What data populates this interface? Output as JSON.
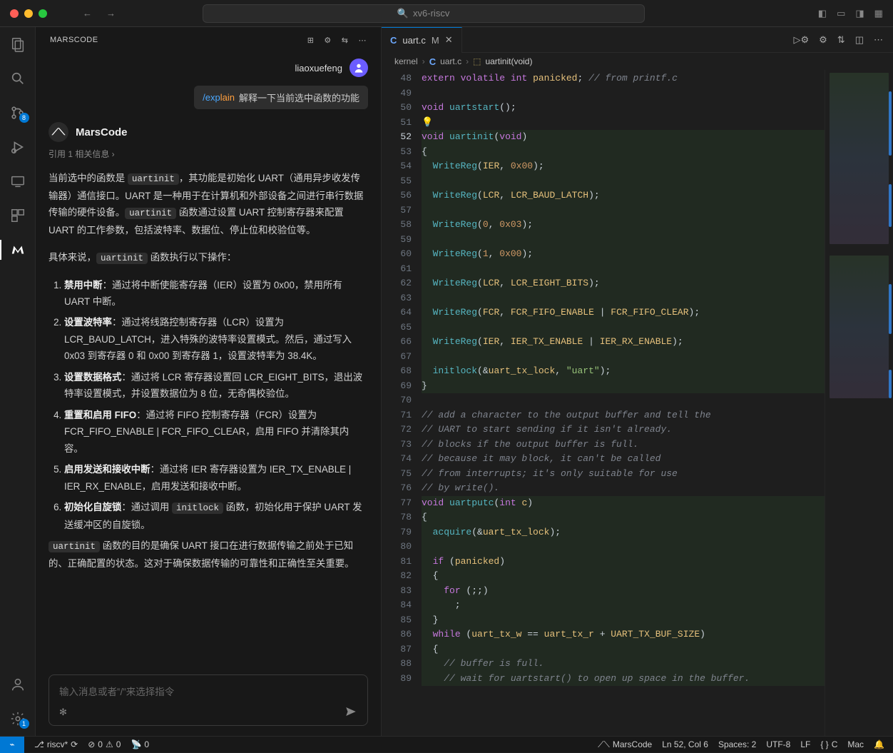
{
  "search": {
    "placeholder": "xv6-riscv"
  },
  "activity": {
    "scm_badge": "8",
    "settings_badge": "1"
  },
  "sidebar": {
    "title": "MARSCODE",
    "username": "liaoxuefeng",
    "explain_cmd_prefix": "/exp",
    "explain_cmd_suffix": "lain",
    "explain_text": "解释一下当前选中函数的功能",
    "assistant": "MarsCode",
    "ref": "引用 1 相关信息 ›",
    "p1a": "当前选中的函数是 ",
    "code_uartinit": "uartinit",
    "p1b": "，其功能是初始化 UART（通用异步收发传输器）通信接口。UART 是一种用于在计算机和外部设备之间进行串行数据传输的硬件设备。",
    "p1c": " 函数通过设置 UART 控制寄存器来配置 UART 的工作参数，包括波特率、数据位、停止位和校验位等。",
    "p2a": "具体来说，",
    "p2b": " 函数执行以下操作：",
    "items": [
      {
        "b": "禁用中断",
        "t": "：通过将中断使能寄存器（IER）设置为 0x00，禁用所有 UART 中断。"
      },
      {
        "b": "设置波特率",
        "t": "：通过将线路控制寄存器（LCR）设置为 LCR_BAUD_LATCH，进入特殊的波特率设置模式。然后，通过写入 0x03 到寄存器 0 和 0x00 到寄存器 1，设置波特率为 38.4K。"
      },
      {
        "b": "设置数据格式",
        "t": "：通过将 LCR 寄存器设置回 LCR_EIGHT_BITS，退出波特率设置模式，并设置数据位为 8 位，无奇偶校验位。"
      },
      {
        "b": "重置和启用 FIFO",
        "t": "：通过将 FIFO 控制寄存器（FCR）设置为 FCR_FIFO_ENABLE | FCR_FIFO_CLEAR，启用 FIFO 并清除其内容。"
      },
      {
        "b": "启用发送和接收中断",
        "t": "：通过将 IER 寄存器设置为 IER_TX_ENABLE | IER_RX_ENABLE，启用发送和接收中断。"
      },
      {
        "b": "初始化自旋锁",
        "t_pre": "：通过调用 ",
        "code": "initlock",
        "t_post": " 函数，初始化用于保护 UART 发送缓冲区的自旋锁。"
      }
    ],
    "p3a": " 函数的目的是确保 UART 接口在进行数据传输之前处于已知的、正确配置的状态。这对于确保数据传输的可靠性和正确性至关重要。",
    "input_placeholder": "输入消息或者‟/”来选择指令"
  },
  "editor": {
    "tab": {
      "lang": "C",
      "name": "uart.c",
      "mod": "M"
    },
    "breadcrumb": {
      "path": "kernel",
      "file": "uart.c",
      "fn": "uartinit(void)"
    },
    "first_line": 48,
    "active_line": 52,
    "lines": [
      {
        "h": "<span class='kw'>extern</span> <span class='kw'>volatile</span> <span class='ty'>int</span> <span class='id'>panicked</span>; <span class='cm'>// from printf.c</span>"
      },
      {
        "h": ""
      },
      {
        "h": "<span class='ty'>void</span> <span class='fn'>uartstart</span>();"
      },
      {
        "h": "💡"
      },
      {
        "hl": true,
        "h": "<span class='ty'>void</span> <span class='fn'>uartinit</span>(<span class='ty'>void</span>)"
      },
      {
        "hl": true,
        "h": "{"
      },
      {
        "hl": true,
        "h": "  <span class='fn'>WriteReg</span>(<span class='id'>IER</span>, <span class='num'>0x00</span>);"
      },
      {
        "hl": true,
        "h": ""
      },
      {
        "hl": true,
        "h": "  <span class='fn'>WriteReg</span>(<span class='id'>LCR</span>, <span class='id'>LCR_BAUD_LATCH</span>);"
      },
      {
        "hl": true,
        "h": ""
      },
      {
        "hl": true,
        "h": "  <span class='fn'>WriteReg</span>(<span class='num'>0</span>, <span class='num'>0x03</span>);"
      },
      {
        "hl": true,
        "h": ""
      },
      {
        "hl": true,
        "h": "  <span class='fn'>WriteReg</span>(<span class='num'>1</span>, <span class='num'>0x00</span>);"
      },
      {
        "hl": true,
        "h": ""
      },
      {
        "hl": true,
        "h": "  <span class='fn'>WriteReg</span>(<span class='id'>LCR</span>, <span class='id'>LCR_EIGHT_BITS</span>);"
      },
      {
        "hl": true,
        "h": ""
      },
      {
        "hl": true,
        "h": "  <span class='fn'>WriteReg</span>(<span class='id'>FCR</span>, <span class='id'>FCR_FIFO_ENABLE</span> | <span class='id'>FCR_FIFO_CLEAR</span>);"
      },
      {
        "hl": true,
        "h": ""
      },
      {
        "hl": true,
        "h": "  <span class='fn'>WriteReg</span>(<span class='id'>IER</span>, <span class='id'>IER_TX_ENABLE</span> | <span class='id'>IER_RX_ENABLE</span>);"
      },
      {
        "hl": true,
        "h": ""
      },
      {
        "hl": true,
        "h": "  <span class='fn'>initlock</span>(&amp;<span class='id'>uart_tx_lock</span>, <span class='str'>\"uart\"</span>);"
      },
      {
        "hl": true,
        "h": "}"
      },
      {
        "h": ""
      },
      {
        "h": "<span class='cm'>// add a character to the output buffer and tell the</span>"
      },
      {
        "h": "<span class='cm'>// UART to start sending if it isn't already.</span>"
      },
      {
        "h": "<span class='cm'>// blocks if the output buffer is full.</span>"
      },
      {
        "h": "<span class='cm'>// because it may block, it can't be called</span>"
      },
      {
        "h": "<span class='cm'>// from interrupts; it's only suitable for use</span>"
      },
      {
        "h": "<span class='cm'>// by write().</span>"
      },
      {
        "hl": true,
        "h": "<span class='ty'>void</span> <span class='fn'>uartputc</span>(<span class='ty'>int</span> <span class='id'>c</span>)"
      },
      {
        "hl": true,
        "h": "{"
      },
      {
        "hl": true,
        "h": "  <span class='fn'>acquire</span>(&amp;<span class='id'>uart_tx_lock</span>);"
      },
      {
        "hl": true,
        "h": ""
      },
      {
        "hl": true,
        "h": "  <span class='kw'>if</span> (<span class='id'>panicked</span>)"
      },
      {
        "hl": true,
        "h": "  {"
      },
      {
        "hl": true,
        "h": "    <span class='kw'>for</span> (;;)"
      },
      {
        "hl": true,
        "h": "      ;"
      },
      {
        "hl": true,
        "h": "  }"
      },
      {
        "hl": true,
        "h": "  <span class='kw'>while</span> (<span class='id'>uart_tx_w</span> == <span class='id'>uart_tx_r</span> + <span class='id'>UART_TX_BUF_SIZE</span>)"
      },
      {
        "hl": true,
        "h": "  {"
      },
      {
        "hl": true,
        "h": "    <span class='cm'>// buffer is full.</span>"
      },
      {
        "hl": true,
        "h": "    <span class='cm'>// wait for uartstart() to open up space in the buffer.</span>"
      }
    ]
  },
  "status": {
    "branch": "riscv*",
    "errors": "0",
    "warnings": "0",
    "ports": "0",
    "marscode": "MarsCode",
    "pos": "Ln 52, Col 6",
    "spaces": "Spaces: 2",
    "enc": "UTF-8",
    "eol": "LF",
    "lang": "C",
    "os": "Mac"
  }
}
